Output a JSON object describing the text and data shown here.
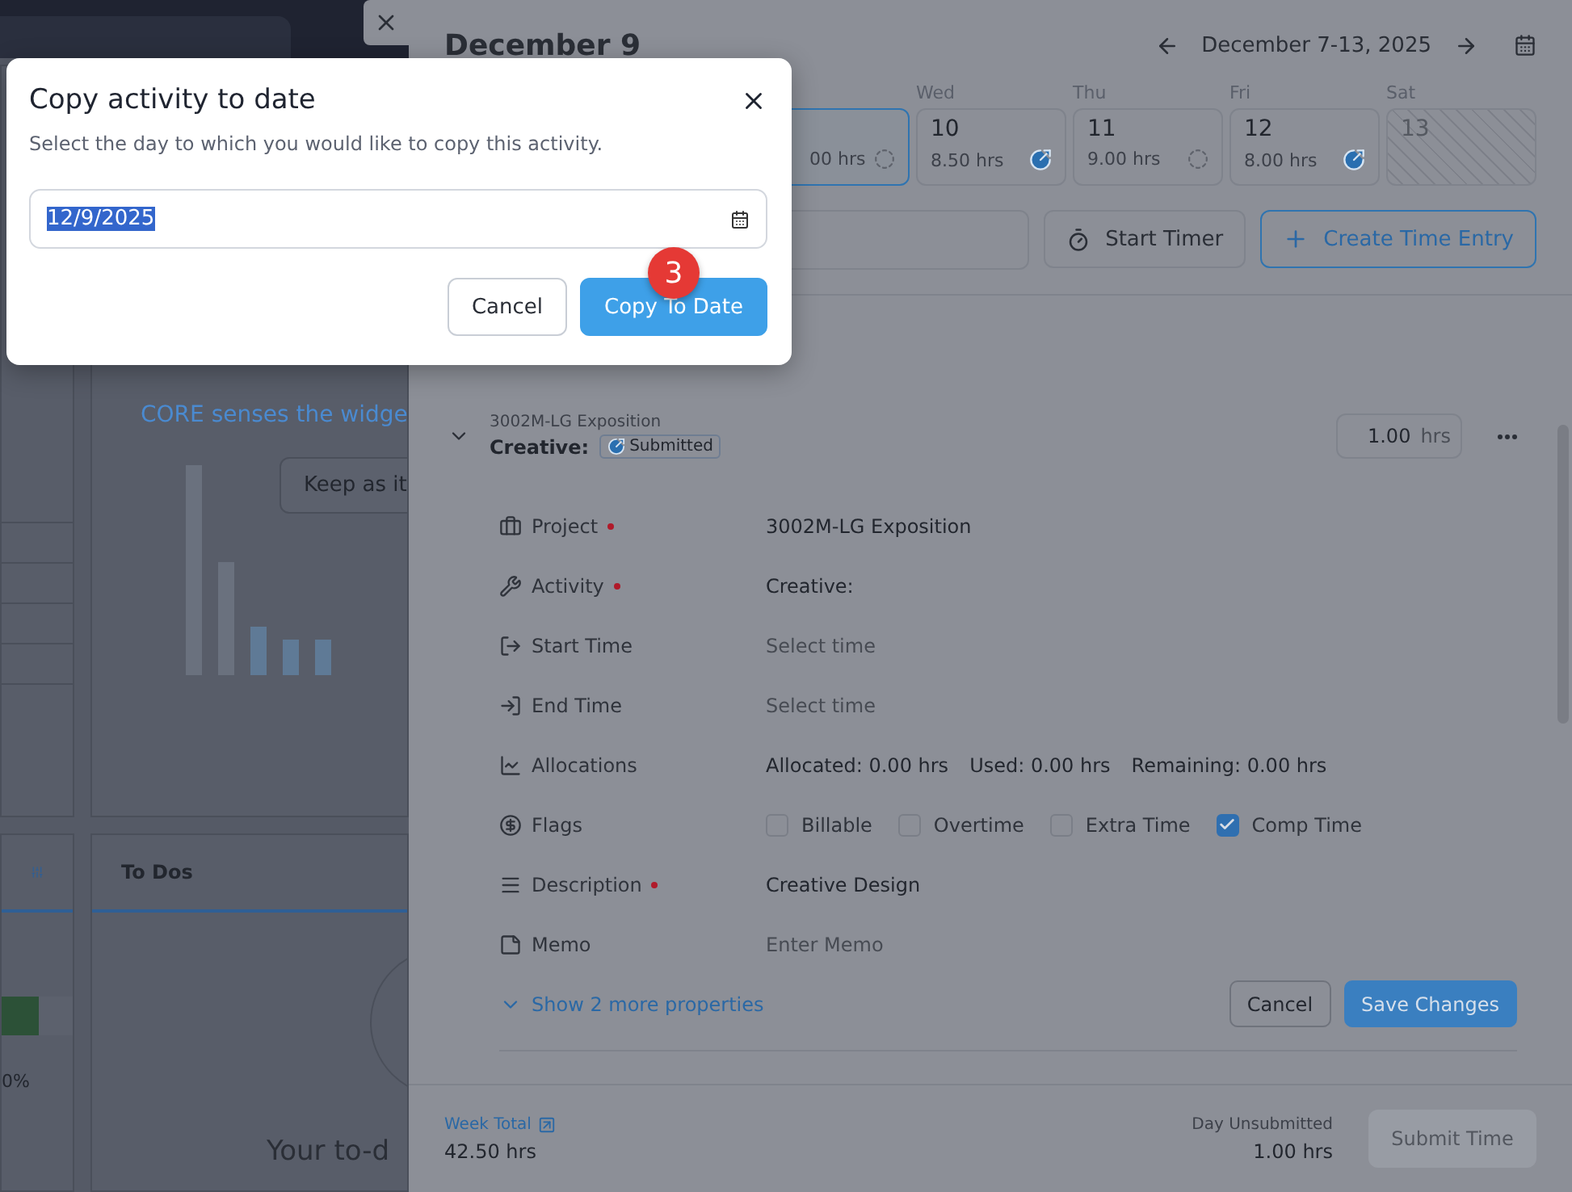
{
  "dashboard": {
    "banner": "CORE senses the widge",
    "keep_button": "Keep as it",
    "todos_title": "To Dos",
    "todos_empty": "Your to-d",
    "progress": {
      "label": "0%",
      "level": 0.52
    }
  },
  "drawer": {
    "title": "December 9",
    "week_range": "December 7-13, 2025",
    "days": [
      {
        "hours": "00 hrs",
        "submitted": false,
        "selected": true,
        "disabled": false
      },
      {
        "weekday": "Wed",
        "number": "10",
        "hours": "8.50 hrs",
        "submitted": true,
        "selected": false,
        "disabled": false
      },
      {
        "weekday": "Thu",
        "number": "11",
        "hours": "9.00 hrs",
        "submitted": false,
        "selected": false,
        "disabled": false
      },
      {
        "weekday": "Fri",
        "number": "12",
        "hours": "8.00 hrs",
        "submitted": true,
        "selected": false,
        "disabled": false
      },
      {
        "weekday": "Sat",
        "number": "13",
        "selected": false,
        "disabled": true
      }
    ],
    "start_timer": "Start Timer",
    "create_entry": "Create Time Entry",
    "entry": {
      "project": "3002M-LG Exposition",
      "activity": "Creative:",
      "status": "Submitted",
      "expanded": true,
      "hours": "1.00",
      "hours_unit": "hrs",
      "properties": [
        {
          "label": "Project",
          "required": true,
          "kind": "text",
          "value": "3002M-LG Exposition"
        },
        {
          "label": "Activity",
          "required": true,
          "kind": "text",
          "value": "Creative:"
        },
        {
          "label": "Start Time",
          "required": false,
          "kind": "placeholder",
          "placeholder": "Select time"
        },
        {
          "label": "End Time",
          "required": false,
          "kind": "placeholder",
          "placeholder": "Select time"
        },
        {
          "label": "Allocations",
          "required": false,
          "kind": "stats",
          "items": [
            "Allocated: 0.00 hrs",
            "Used: 0.00 hrs",
            "Remaining: 0.00 hrs"
          ]
        },
        {
          "label": "Flags",
          "required": false,
          "kind": "flags",
          "flags": [
            {
              "label": "Billable",
              "checked": false
            },
            {
              "label": "Overtime",
              "checked": false
            },
            {
              "label": "Extra Time",
              "checked": false
            },
            {
              "label": "Comp Time",
              "checked": true
            }
          ]
        },
        {
          "label": "Description",
          "required": true,
          "kind": "text",
          "value": "Creative Design"
        },
        {
          "label": "Memo",
          "required": false,
          "kind": "placeholder",
          "placeholder": "Enter Memo"
        }
      ],
      "more_link": "Show 2 more properties",
      "cancel": "Cancel",
      "save": "Save Changes"
    },
    "footer": {
      "week_total_label": "Week Total",
      "week_total": "42.50 hrs",
      "day_label": "Day Unsubmitted",
      "day_total": "1.00 hrs",
      "submit": "Submit Time",
      "submit_disabled": true
    }
  },
  "dialog": {
    "title": "Copy activity to date",
    "description": "Select the day to which you would like to copy this activity.",
    "date": "12/9/2025",
    "date_selected": true,
    "cancel": "Cancel",
    "confirm": "Copy To Date",
    "step_badge": "3"
  }
}
